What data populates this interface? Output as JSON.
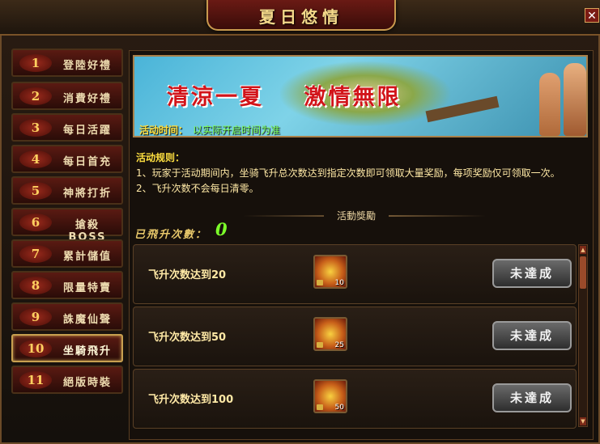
{
  "window": {
    "title": "夏日悠情",
    "close_symbol": "✕"
  },
  "sidebar": {
    "items": [
      {
        "num": "1",
        "label": "登陸好禮",
        "active": true
      },
      {
        "num": "2",
        "label": "消費好禮",
        "active": false
      },
      {
        "num": "3",
        "label": "每日活躍",
        "active": false
      },
      {
        "num": "4",
        "label": "每日首充",
        "active": false
      },
      {
        "num": "5",
        "label": "神將打折",
        "active": false
      },
      {
        "num": "6",
        "label": "搶殺BOSS",
        "active": false
      },
      {
        "num": "7",
        "label": "累計儲值",
        "active": false
      },
      {
        "num": "8",
        "label": "限量特賣",
        "active": false
      },
      {
        "num": "9",
        "label": "誅魔仙聲",
        "active": false
      },
      {
        "num": "10",
        "label": "坐騎飛升",
        "active": true
      },
      {
        "num": "11",
        "label": "絕版時裝",
        "active": false
      }
    ]
  },
  "banner": {
    "slogan": "清涼一夏    激情無限",
    "time_label": "活动时间：",
    "time_value": "以实际开启时间为准"
  },
  "rules": {
    "title": "活动规则：",
    "line1": "1、玩家于活动期间内，坐骑飞升总次数达到指定次数即可领取大量奖励，每项奖励仅可领取一次。",
    "line2": "2、飞升次数不会每日清零。"
  },
  "section": {
    "title": "活動獎勵"
  },
  "counter": {
    "label": "已飛升次數：",
    "value": "0"
  },
  "rewards": [
    {
      "text": "飞升次数达到20",
      "qty": "10",
      "status": "未達成",
      "icon": "gold-medal-icon"
    },
    {
      "text": "飞升次数达到50",
      "qty": "25",
      "status": "未達成",
      "icon": "gold-medal-icon"
    },
    {
      "text": "飞升次数达到100",
      "qty": "50",
      "status": "未達成",
      "icon": "gold-medal-icon"
    }
  ],
  "scroll": {
    "up": "▲",
    "down": "▼"
  }
}
